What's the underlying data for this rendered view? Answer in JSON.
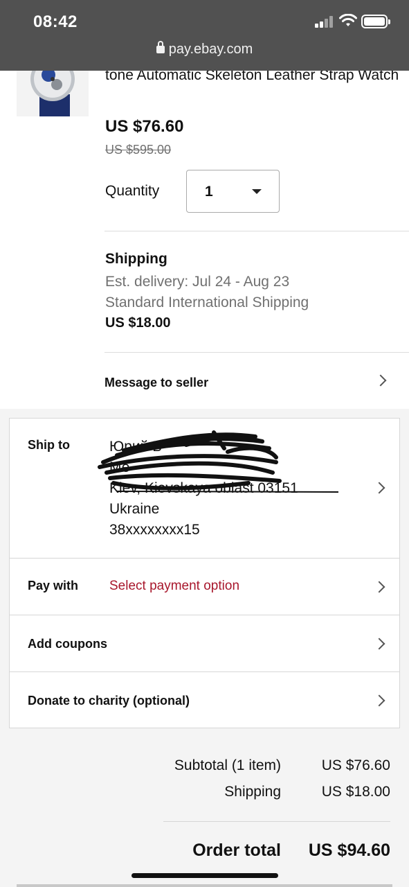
{
  "status_bar": {
    "time": "08:42",
    "url": "pay.ebay.com"
  },
  "item": {
    "title": "tone Automatic Skeleton Leather Strap Watch",
    "price": "US $76.60",
    "original_price": "US $595.00",
    "quantity_label": "Quantity",
    "quantity_value": "1"
  },
  "shipping": {
    "heading": "Shipping",
    "delivery": "Est. delivery: Jul 24 - Aug 23",
    "method": "Standard International Shipping",
    "cost": "US $18.00"
  },
  "message_to_seller": "Message to seller",
  "ship_to": {
    "label": "Ship to",
    "address_lines": [
      "Юрий Б",
      "Ме",
      "Kiev, Kievskaya oblast 03151",
      "Ukraine",
      "38xxxxxxxx15"
    ]
  },
  "pay_with": {
    "label": "Pay with",
    "value": "Select payment option"
  },
  "coupons_label": "Add coupons",
  "charity_label": "Donate to charity (optional)",
  "summary": {
    "subtotal_label": "Subtotal (1 item)",
    "subtotal_value": "US $76.60",
    "shipping_label": "Shipping",
    "shipping_value": "US $18.00",
    "total_label": "Order total",
    "total_value": "US $94.60"
  },
  "colors": {
    "status_bar_bg": "#515151",
    "pay_option_red": "#a8172c",
    "page_bg": "#f4f4f4"
  }
}
